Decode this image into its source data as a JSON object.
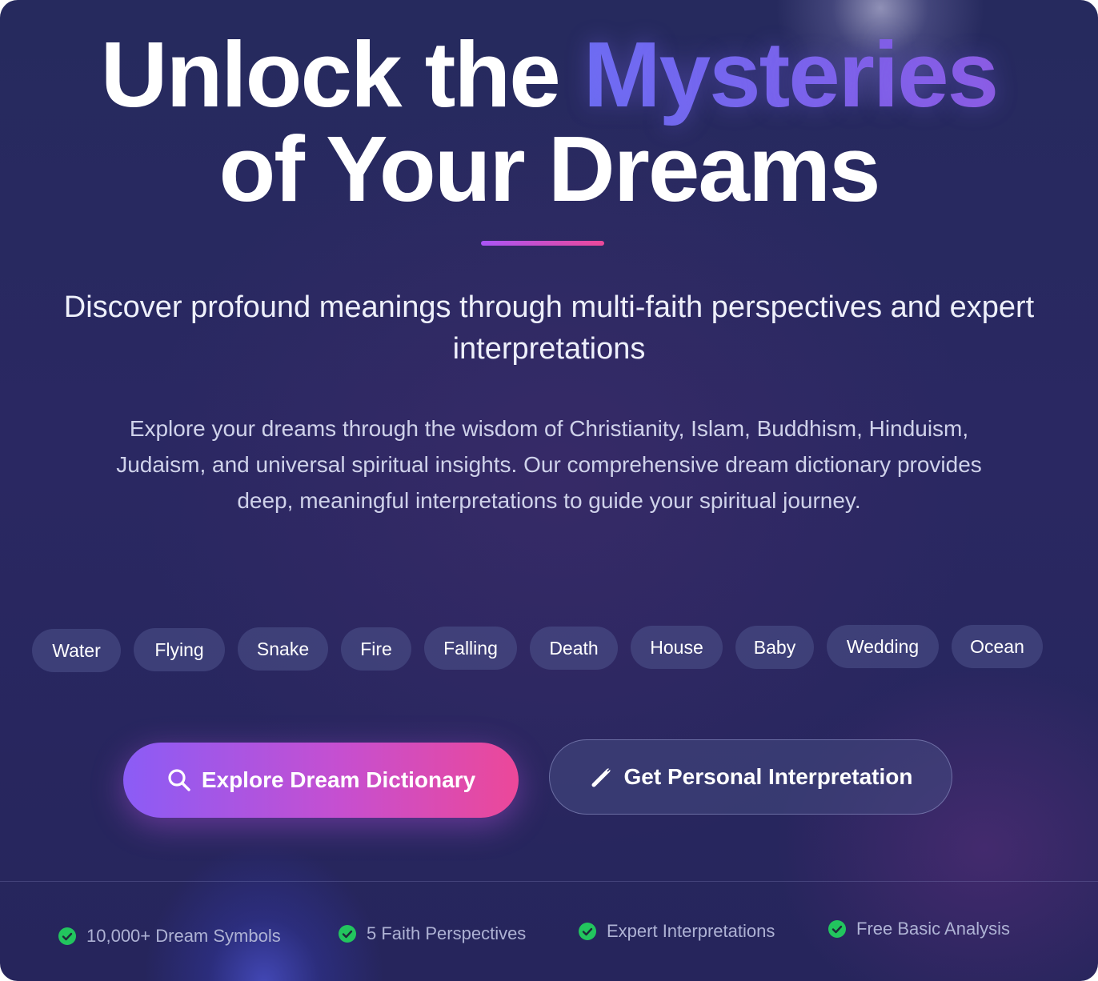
{
  "hero": {
    "title_line1_prefix": "Unlock the ",
    "title_line1_accent": "Mysteries",
    "title_line2": "of Your Dreams",
    "subtitle": "Discover profound meanings through multi-faith perspectives and expert interpretations",
    "description": "Explore your dreams through the wisdom of Christianity, Islam, Buddhism, Hinduism, Judaism, and universal spiritual insights. Our comprehensive dream dictionary provides deep, meaningful interpretations to guide your spiritual journey."
  },
  "tags": [
    "Water",
    "Flying",
    "Snake",
    "Fire",
    "Falling",
    "Death",
    "House",
    "Baby",
    "Wedding",
    "Ocean"
  ],
  "buttons": {
    "primary_label": "Explore Dream Dictionary",
    "primary_icon": "search-icon",
    "secondary_label": "Get Personal Interpretation",
    "secondary_icon": "pencil-icon"
  },
  "features": [
    "10,000+ Dream Symbols",
    "5 Faith Perspectives",
    "Expert Interpretations",
    "Free Basic Analysis"
  ],
  "colors": {
    "background": "#28285f",
    "accent_gradient_start": "#8b5cf6",
    "accent_gradient_end": "#ec4899",
    "check_green": "#22c55e"
  }
}
